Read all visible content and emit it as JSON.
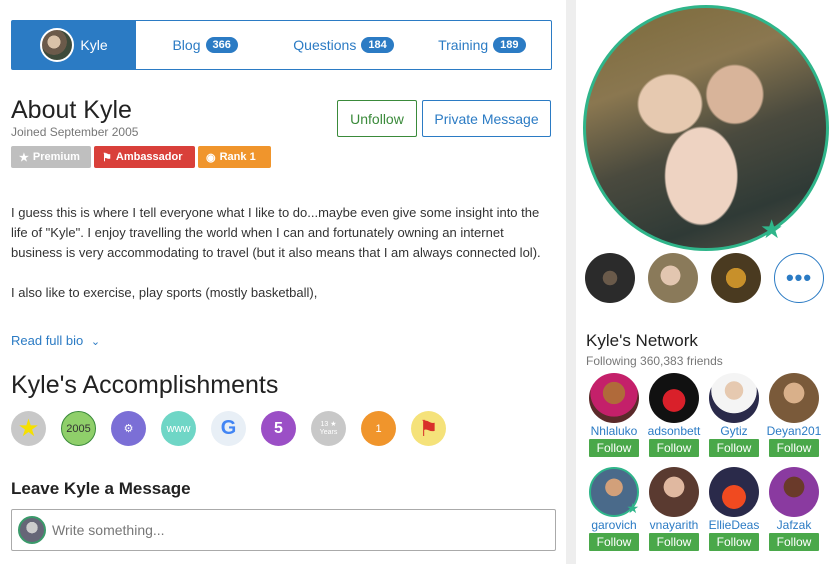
{
  "tabs": {
    "profile": "Kyle",
    "blog": {
      "label": "Blog",
      "count": "366"
    },
    "questions": {
      "label": "Questions",
      "count": "184"
    },
    "training": {
      "label": "Training",
      "count": "189"
    }
  },
  "about": {
    "title": "About Kyle",
    "joined": "Joined September 2005",
    "unfollow": "Unfollow",
    "private_message": "Private Message",
    "badges": {
      "premium": "Premium",
      "ambassador": "Ambassador",
      "rank": "Rank 1"
    },
    "bio": [
      "I guess this is where I tell everyone what I like to do...maybe even give some insight into the life of \"Kyle\". I enjoy travelling the world when I can and fortunately owning an internet business is very accommodating to travel (but it also means that I am always connected lol).",
      "I also like to exercise, play sports (mostly basketball),"
    ],
    "read_more": "Read full bio"
  },
  "accomplishments": {
    "title": "Kyle's Accomplishments",
    "items": [
      {
        "icon": "star-icon",
        "color": "#c8c8c8",
        "text": "★"
      },
      {
        "icon": "year-2005-icon",
        "color": "#8fcf6a",
        "text": "2005"
      },
      {
        "icon": "user-gear-icon",
        "color": "#7b6fd6",
        "text": "⚙"
      },
      {
        "icon": "www-icon",
        "color": "#6fd6c6",
        "text": "www"
      },
      {
        "icon": "google-icon",
        "color": "#e8eff6",
        "text": "G"
      },
      {
        "icon": "five-ribbon-icon",
        "color": "#9b4fc6",
        "text": "5"
      },
      {
        "icon": "13-years-icon",
        "color": "#c8c8c8",
        "text": "13 ★ Years"
      },
      {
        "icon": "one-medal-icon",
        "color": "#f0952c",
        "text": "1"
      },
      {
        "icon": "flag-icon",
        "color": "#f5e27a",
        "text": "⚑"
      }
    ]
  },
  "message": {
    "title": "Leave Kyle a Message",
    "placeholder": "Write something..."
  },
  "network": {
    "title": "Kyle's Network",
    "subtitle": "Following 360,383 friends",
    "follow_label": "Follow",
    "friends": [
      {
        "name": "Nhlaluko"
      },
      {
        "name": "adsonbett"
      },
      {
        "name": "Gytiz"
      },
      {
        "name": "Deyan201"
      },
      {
        "name": "garovich"
      },
      {
        "name": "vnayarith"
      },
      {
        "name": "EllieDeas"
      },
      {
        "name": "Jafzak"
      }
    ]
  },
  "colors": {
    "accent": "#2b7bc4",
    "follow": "#4aa84a",
    "premium_ring": "#2fb58a"
  }
}
